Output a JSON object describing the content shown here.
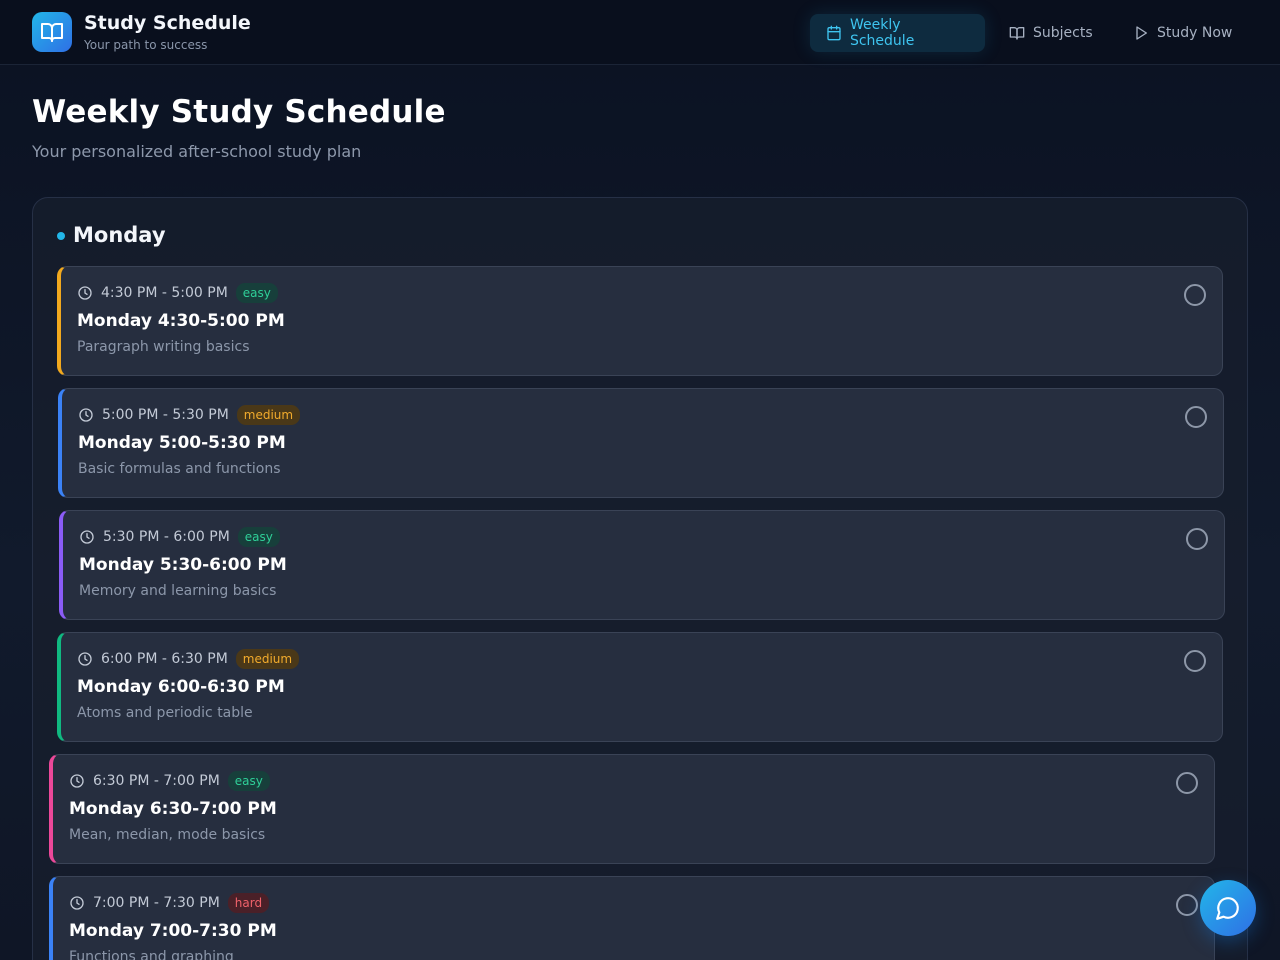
{
  "brand": {
    "title": "Study Schedule",
    "subtitle": "Your path to success",
    "icon": "book-open-icon"
  },
  "nav": [
    {
      "label": "Weekly Schedule",
      "icon": "calendar-icon",
      "active": true
    },
    {
      "label": "Subjects",
      "icon": "book-icon",
      "active": false
    },
    {
      "label": "Study Now",
      "icon": "play-icon",
      "active": false
    }
  ],
  "page": {
    "title": "Weekly Study Schedule",
    "subtitle": "Your personalized after-school study plan"
  },
  "day": {
    "name": "Monday",
    "sessions": [
      {
        "time": "4:30 PM - 5:00 PM",
        "difficulty": "easy",
        "title": "Monday 4:30-5:00 PM",
        "description": "Paragraph writing basics",
        "accent": "#f2a91e",
        "completed": false
      },
      {
        "time": "5:00 PM - 5:30 PM",
        "difficulty": "medium",
        "title": "Monday 5:00-5:30 PM",
        "description": "Basic formulas and functions",
        "accent": "#3b82f6",
        "completed": false
      },
      {
        "time": "5:30 PM - 6:00 PM",
        "difficulty": "easy",
        "title": "Monday 5:30-6:00 PM",
        "description": "Memory and learning basics",
        "accent": "#8b5cf6",
        "completed": false
      },
      {
        "time": "6:00 PM - 6:30 PM",
        "difficulty": "medium",
        "title": "Monday 6:00-6:30 PM",
        "description": "Atoms and periodic table",
        "accent": "#10b981",
        "completed": false
      },
      {
        "time": "6:30 PM - 7:00 PM",
        "difficulty": "easy",
        "title": "Monday 6:30-7:00 PM",
        "description": "Mean, median, mode basics",
        "accent": "#ec4899",
        "completed": false
      },
      {
        "time": "7:00 PM - 7:30 PM",
        "difficulty": "hard",
        "title": "Monday 7:00-7:30 PM",
        "description": "Functions and graphing",
        "accent": "#3b82f6",
        "completed": false
      }
    ]
  },
  "chat": {
    "icon": "chat-bubble-icon"
  }
}
